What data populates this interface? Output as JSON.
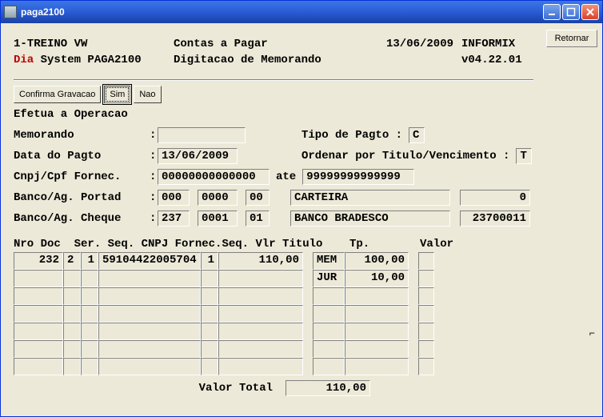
{
  "window": {
    "title": "paga2100"
  },
  "sidebar": {
    "retornar": "Retornar"
  },
  "header": {
    "line1_left": "1-TREINO VW",
    "line1_center": "Contas a Pagar",
    "line1_date": "13/06/2009",
    "line1_right": "INFORMIX",
    "line2_left_prefix": "Dia",
    "line2_left_rest": " System  PAGA2100",
    "line2_center": "Digitacao de Memorando",
    "line2_right": "v04.22.01"
  },
  "buttons": {
    "confirma": "Confirma Gravacao",
    "sim": "Sim",
    "nao": "Nao"
  },
  "section": "Efetua a Operacao",
  "fields": {
    "memorando_label": "Memorando       ",
    "memorando_value": "",
    "tipo_pagto_label": "Tipo de Pagto : ",
    "tipo_pagto_value": "C",
    "data_pagto_label": "Data do Pagto   ",
    "data_pagto_value": "13/06/2009",
    "ordenar_label": "Ordenar por Titulo/Vencimento : ",
    "ordenar_value": "T",
    "cnpj_label": "Cnpj/Cpf Fornec.",
    "cnpj_from": "00000000000000",
    "ate": "ate",
    "cnpj_to": "99999999999999",
    "banco_portad_label": "Banco/Ag. Portad",
    "portad_banco": "000",
    "portad_ag": "0000",
    "portad_dig": "00",
    "portad_nome": "CARTEIRA",
    "portad_saldo": "0",
    "banco_cheque_label": "Banco/Ag. Cheque ",
    "cheque_banco": "237",
    "cheque_ag": "0001",
    "cheque_dig": "01",
    "cheque_nome": "BANCO BRADESCO",
    "cheque_num": "23700011"
  },
  "table_headers": {
    "left": "Nro Doc  Ser. Seq. CNPJ Fornec.Seq. Vlr Titulo",
    "tp": "Tp.",
    "valor": "Valor"
  },
  "rowsA": [
    {
      "nrodoc": "232",
      "ser": "2",
      "seq": "1",
      "cnpj": "59104422005704",
      "seq2": "1",
      "vlr": "110,00"
    },
    {
      "nrodoc": "",
      "ser": "",
      "seq": "",
      "cnpj": "",
      "seq2": "",
      "vlr": ""
    },
    {
      "nrodoc": "",
      "ser": "",
      "seq": "",
      "cnpj": "",
      "seq2": "",
      "vlr": ""
    },
    {
      "nrodoc": "",
      "ser": "",
      "seq": "",
      "cnpj": "",
      "seq2": "",
      "vlr": ""
    },
    {
      "nrodoc": "",
      "ser": "",
      "seq": "",
      "cnpj": "",
      "seq2": "",
      "vlr": ""
    },
    {
      "nrodoc": "",
      "ser": "",
      "seq": "",
      "cnpj": "",
      "seq2": "",
      "vlr": ""
    },
    {
      "nrodoc": "",
      "ser": "",
      "seq": "",
      "cnpj": "",
      "seq2": "",
      "vlr": ""
    }
  ],
  "rowsB": [
    {
      "tp": "MEM",
      "valor": "100,00"
    },
    {
      "tp": "JUR",
      "valor": "10,00"
    },
    {
      "tp": "",
      "valor": ""
    },
    {
      "tp": "",
      "valor": ""
    },
    {
      "tp": "",
      "valor": ""
    },
    {
      "tp": "",
      "valor": ""
    },
    {
      "tp": "",
      "valor": ""
    }
  ],
  "rowsC": [
    {
      "c": ""
    },
    {
      "c": ""
    },
    {
      "c": ""
    },
    {
      "c": ""
    },
    {
      "c": ""
    },
    {
      "c": ""
    },
    {
      "c": ""
    }
  ],
  "total": {
    "label": "Valor Total",
    "value": "110,00"
  }
}
